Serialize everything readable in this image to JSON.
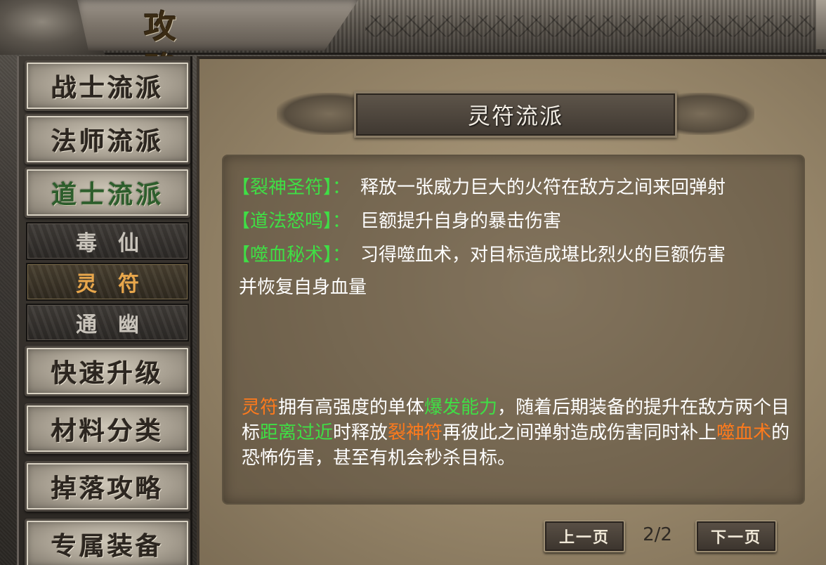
{
  "window": {
    "title": "攻略"
  },
  "sidebar": {
    "items": [
      {
        "label": "战士流派"
      },
      {
        "label": "法师流派"
      },
      {
        "label": "道士流派"
      },
      {
        "label": "快速升级"
      },
      {
        "label": "材料分类"
      },
      {
        "label": "掉落攻略"
      },
      {
        "label": "专属装备"
      }
    ],
    "active_item": "道士流派",
    "sub_items": [
      {
        "label": "毒仙"
      },
      {
        "label": "灵符"
      },
      {
        "label": "通幽"
      }
    ],
    "selected_sub_item": "灵符"
  },
  "main": {
    "heading": "灵符流派",
    "skills": [
      {
        "name": "【裂神圣符】",
        "separator": "：",
        "desc": "释放一张威力巨大的火符在敌方之间来回弹射"
      },
      {
        "name": "【道法怒鸣】",
        "separator": "：",
        "desc": "巨额提升自身的暴击伤害"
      },
      {
        "name": "【噬血秘术】",
        "separator": "：",
        "desc": "习得噬血术，对目标造成堪比烈火的巨额伤害"
      }
    ],
    "skill_continuation": "并恢复自身血量",
    "description": {
      "p1": "灵符",
      "p2": "拥有高强度的单体",
      "p3": "爆发能力",
      "p4": "，随着后期装备的提升在敌方两个目标",
      "p5": "距离过近",
      "p6": "时释放",
      "p7": "裂神符",
      "p8": "再彼此之间弹射造成伤害同时补上",
      "p9": "噬血术",
      "p10": "的恐怖伤害，甚至有机会秒杀目标。"
    }
  },
  "pager": {
    "prev_label": "上一页",
    "next_label": "下一页",
    "page_display": "2/2"
  },
  "colors": {
    "skill_name": "#3fdf45",
    "highlight_orange": "#ff7a1c",
    "highlight_green": "#3fdf45",
    "sub_selected": "#e8a74c"
  }
}
